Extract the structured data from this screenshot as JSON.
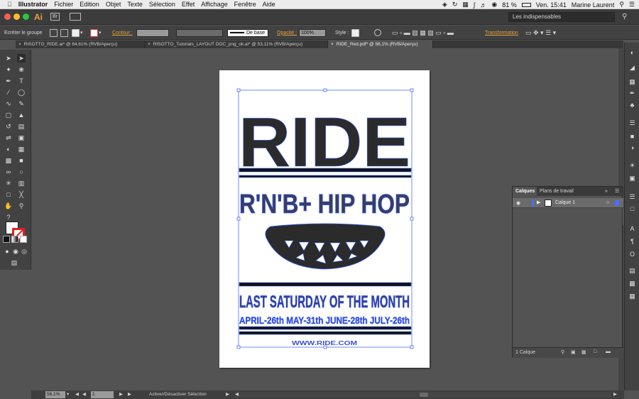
{
  "menubar": {
    "app": "Illustrator",
    "items": [
      "Fichier",
      "Edition",
      "Objet",
      "Texte",
      "Sélection",
      "Effet",
      "Affichage",
      "Fenêtre",
      "Aide"
    ],
    "battery": "81 %",
    "clock": "Ven. 15:41",
    "user": "Marine Laurent"
  },
  "appbar": {
    "logo": "Ai",
    "workspace": "Les indispensables",
    "search_icon": "search-icon"
  },
  "ctrlbar": {
    "selection_label": "Ecréter le groupe",
    "contour_label": "Contour :",
    "stroke_profile": "De base",
    "opacity_label": "Opacité :",
    "opacity_value": "100%",
    "style_label": "Style :",
    "transform_label": "Transformation"
  },
  "tabs": [
    {
      "label": "RISOTTO_RIDE.ai* @ 64,61% (RVB/Aperçu)"
    },
    {
      "label": "RISOTTO_Tutorials_LAYOUT DOC_png_ok.ai* @ 53,11% (RVB/Aperçu)"
    },
    {
      "label": "RIDE_Red.pdf* @ 56,1% (RVB/Aperçu)"
    }
  ],
  "artwork": {
    "title": "RIDE",
    "subtitle": "R'N'B+ HIP HOP",
    "tagline": "LAST SATURDAY OF THE MONTH",
    "dates": "APRIL-26th   MAY-31th   JUNE-28th   JULY-26th",
    "footer": "WWW.RIDE.COM"
  },
  "layers": {
    "tab_active": "Calques",
    "tab_inactive": "Plans de travail",
    "layer_name": "Calque 1",
    "count": "1 Calque"
  },
  "status": {
    "zoom": "56,1%",
    "page": "1",
    "tool": "Activer/Désactiver Sélection"
  },
  "colors": {
    "ui_dark": "#424242",
    "canvas": "#535353",
    "selection": "#2f5bff",
    "ink": "#2b2b2b"
  }
}
